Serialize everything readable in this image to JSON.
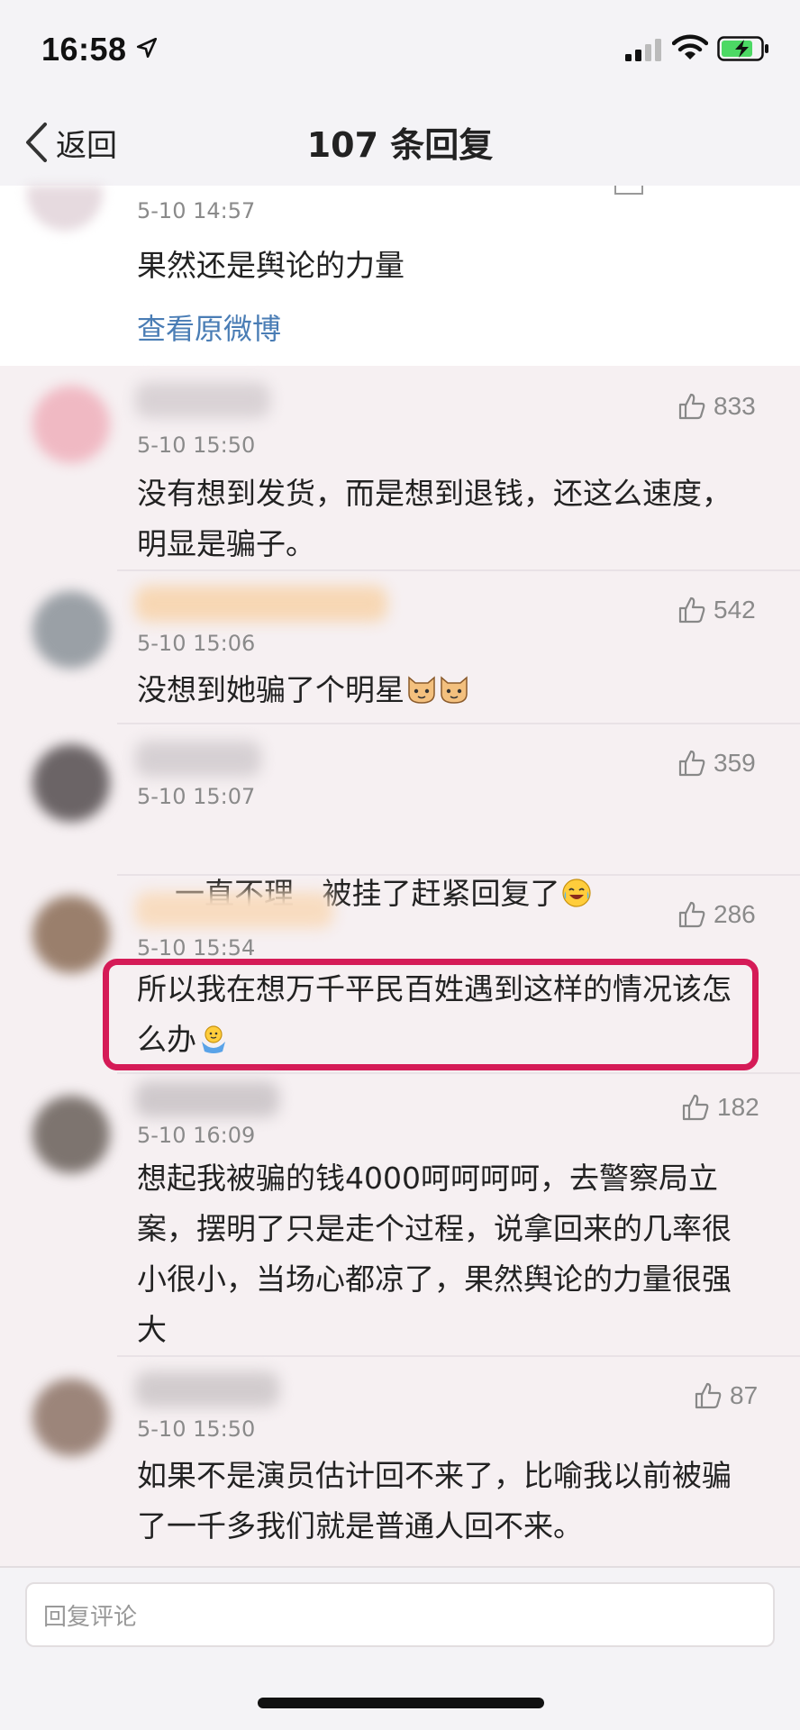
{
  "status_bar": {
    "time": "16:58"
  },
  "nav": {
    "back_label": "返回",
    "title": "107 条回复"
  },
  "origin": {
    "time": "5-10 14:57",
    "text": "果然还是舆论的力量",
    "link": "查看原微博"
  },
  "comments": [
    {
      "time": "5-10 15:50",
      "likes": "833",
      "lines": [
        "没有想到发货，而是想到退钱，还这么速度，",
        "明显是骗子。"
      ]
    },
    {
      "time": "5-10 15:06",
      "likes": "542",
      "text": "没想到她骗了个明星"
    },
    {
      "time": "5-10 15:07",
      "likes": "359",
      "text": "一直不理   被挂了赶紧回复了"
    },
    {
      "time": "5-10 15:54",
      "likes": "286",
      "lines": [
        "所以我在想万千平民百姓遇到这样的情况该怎",
        "么办"
      ]
    },
    {
      "time": "5-10 16:09",
      "likes": "182",
      "lines": [
        "想起我被骗的钱4000呵呵呵呵，去警察局立",
        "案，摆明了只是走个过程，说拿回来的几率很",
        "小很小，当场心都凉了，果然舆论的力量很强",
        "大"
      ]
    },
    {
      "time": "5-10 15:50",
      "likes": "87",
      "lines": [
        "如果不是演员估计回不来了，比喻我以前被骗",
        "了一千多我们就是普通人回不来。"
      ]
    }
  ],
  "reply": {
    "placeholder": "回复评论"
  },
  "colors": {
    "accent_link": "#4a7db5",
    "highlight": "#d51b57"
  },
  "icons": [
    "location-arrow-icon",
    "signal-icon",
    "wifi-icon",
    "battery-charging-icon",
    "back-chevron-icon",
    "thumbs-up-icon",
    "cat-emoji-icon",
    "laugh-cry-emoji-icon",
    "shrug-emoji-icon"
  ]
}
